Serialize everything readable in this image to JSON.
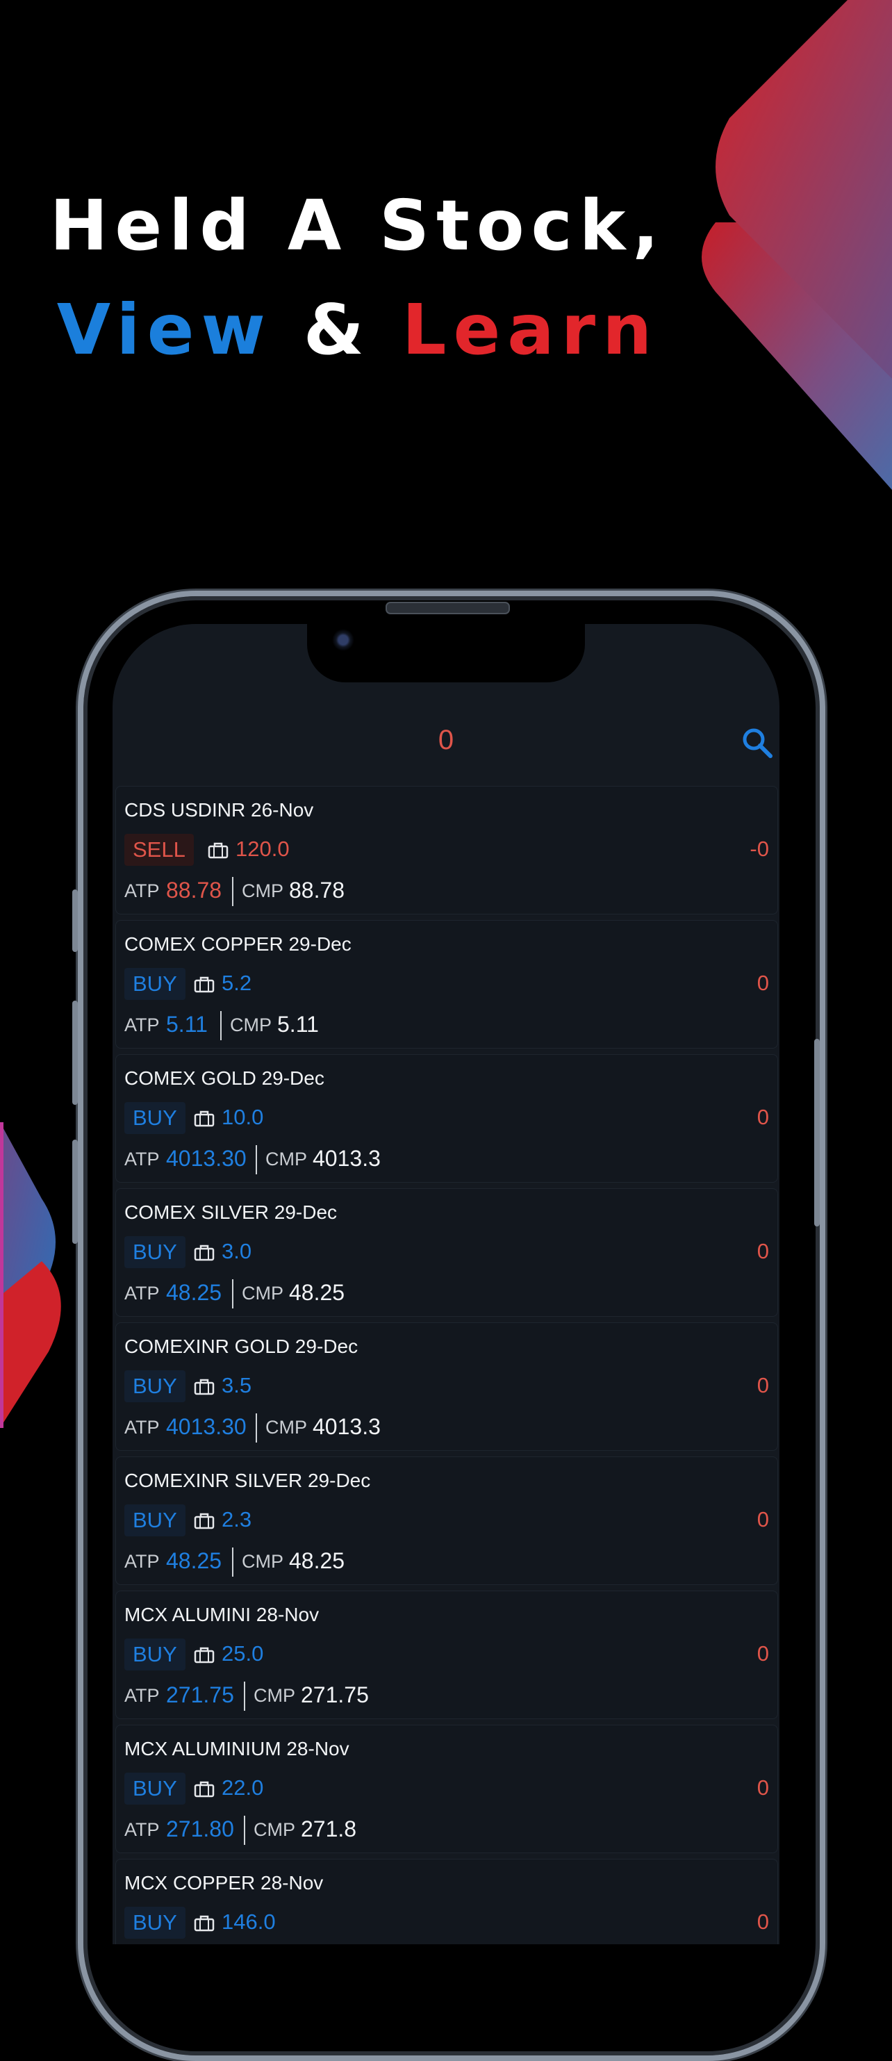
{
  "headline": {
    "line1": "Held A Stock,",
    "line2_a": "View",
    "line2_b": "&",
    "line2_c": "Learn"
  },
  "colors": {
    "accent_blue": "#1b7fdc",
    "accent_red": "#e2262b",
    "sell": "#e0554a",
    "buy": "#1f7fe0"
  },
  "header": {
    "count": "0",
    "search_icon": "search-icon"
  },
  "labels": {
    "atp": "ATP",
    "cmp": "CMP"
  },
  "positions": [
    {
      "symbol": "CDS USDINR 26-Nov",
      "side": "SELL",
      "qty": "120.0",
      "pnl": "-0",
      "atp": "88.78",
      "cmp": "88.78"
    },
    {
      "symbol": "COMEX COPPER 29-Dec",
      "side": "BUY",
      "qty": "5.2",
      "pnl": "0",
      "atp": "5.11",
      "cmp": "5.11"
    },
    {
      "symbol": "COMEX GOLD 29-Dec",
      "side": "BUY",
      "qty": "10.0",
      "pnl": "0",
      "atp": "4013.30",
      "cmp": "4013.3"
    },
    {
      "symbol": "COMEX SILVER 29-Dec",
      "side": "BUY",
      "qty": "3.0",
      "pnl": "0",
      "atp": "48.25",
      "cmp": "48.25"
    },
    {
      "symbol": "COMEXINR GOLD 29-Dec",
      "side": "BUY",
      "qty": "3.5",
      "pnl": "0",
      "atp": "4013.30",
      "cmp": "4013.3"
    },
    {
      "symbol": "COMEXINR SILVER 29-Dec",
      "side": "BUY",
      "qty": "2.3",
      "pnl": "0",
      "atp": "48.25",
      "cmp": "48.25"
    },
    {
      "symbol": "MCX ALUMINI 28-Nov",
      "side": "BUY",
      "qty": "25.0",
      "pnl": "0",
      "atp": "271.75",
      "cmp": "271.75"
    },
    {
      "symbol": "MCX ALUMINIUM 28-Nov",
      "side": "BUY",
      "qty": "22.0",
      "pnl": "0",
      "atp": "271.80",
      "cmp": "271.8"
    },
    {
      "symbol": "MCX COPPER 28-Nov",
      "side": "BUY",
      "qty": "146.0",
      "pnl": "0",
      "atp": "",
      "cmp": ""
    }
  ]
}
